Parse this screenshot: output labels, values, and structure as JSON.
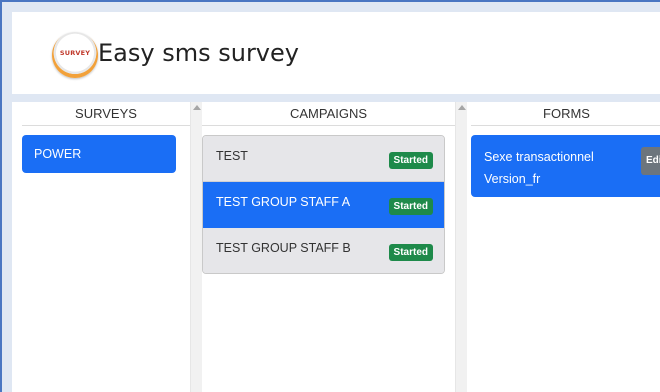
{
  "app": {
    "title": "Easy sms survey",
    "logo_text": "SURVEY"
  },
  "columns": {
    "surveys": {
      "header": "SURVEYS",
      "items": [
        {
          "label": "POWER",
          "selected": true
        }
      ]
    },
    "campaigns": {
      "header": "CAMPAIGNS",
      "items": [
        {
          "label": "TEST",
          "status": "Started",
          "selected": false
        },
        {
          "label": "TEST GROUP STAFF A",
          "status": "Started",
          "selected": true
        },
        {
          "label": "TEST GROUP STAFF B",
          "status": "Started",
          "selected": false
        }
      ]
    },
    "forms": {
      "header": "FORMS",
      "items": [
        {
          "line1": "Sexe transactionnel",
          "line2": "Version_fr",
          "action": "Edi"
        }
      ]
    }
  },
  "colors": {
    "primary": "#1a6ef5",
    "started_badge": "#1e8a4a",
    "edit_badge": "#6c757d"
  }
}
